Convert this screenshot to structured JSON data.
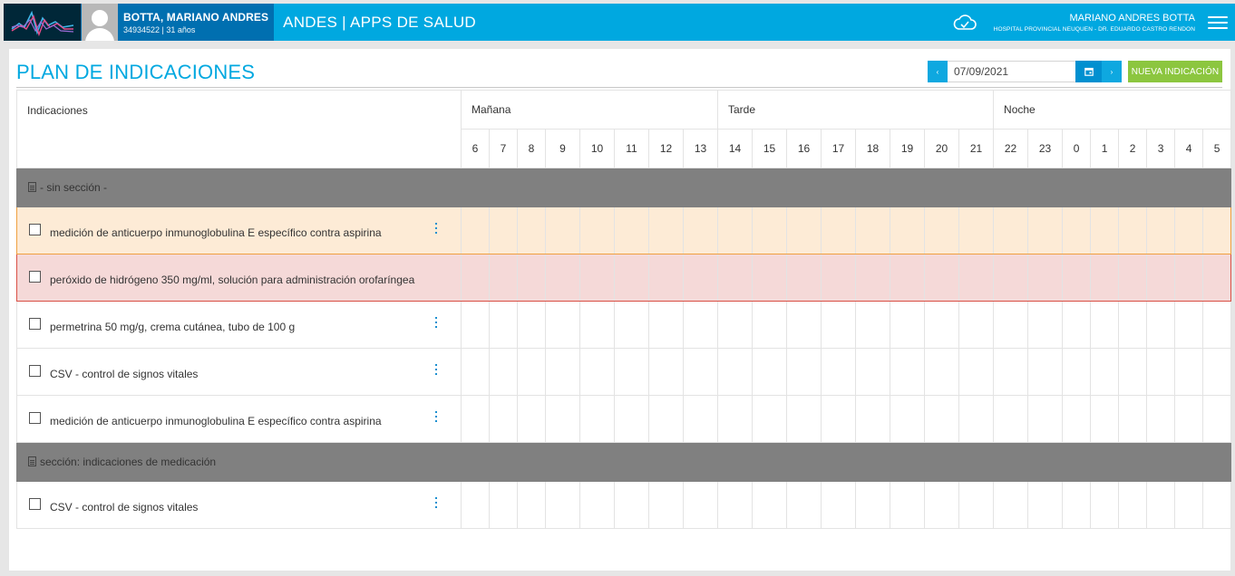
{
  "topbar": {
    "patient_name": "BOTTA, MARIANO ANDRES",
    "patient_doc": "34934522 | 31 años",
    "app_title": "ANDES | APPS DE SALUD",
    "user_name": "MARIANO ANDRES BOTTA",
    "user_hospital": "HOSPITAL PROVINCIAL NEUQUEN - DR. EDUARDO CASTRO RENDON",
    "icons": [
      "andes-logo-icon",
      "avatar-icon",
      "cloud-check-icon",
      "hamburger-menu-icon"
    ]
  },
  "page": {
    "title": "PLAN DE INDICACIONES",
    "date_value": "07/09/2021",
    "prev_glyph": "‹",
    "next_glyph": "›",
    "new_button": "NUEVA INDICACIÓN"
  },
  "table": {
    "col_indicaciones": "Indicaciones",
    "groups": [
      "Mañana",
      "Tarde",
      "Noche"
    ],
    "hours": [
      "6",
      "7",
      "8",
      "9",
      "10",
      "11",
      "12",
      "13",
      "14",
      "15",
      "16",
      "17",
      "18",
      "19",
      "20",
      "21",
      "22",
      "23",
      "0",
      "1",
      "2",
      "3",
      "4",
      "5"
    ],
    "sections": [
      {
        "label": "- sin sección -",
        "rows": [
          {
            "text": "medición de anticuerpo inmunoglobulina E específico contra aspirina",
            "status": "warning",
            "menu": true
          },
          {
            "text": "peróxido de hidrógeno 350 mg/ml, solución para administración orofaríngea",
            "status": "danger",
            "menu": false
          },
          {
            "text": "permetrina 50 mg/g, crema cutánea, tubo de 100 g",
            "status": "normal",
            "menu": true
          },
          {
            "text": "CSV - control de signos vitales",
            "status": "normal",
            "menu": true
          },
          {
            "text": "medición de anticuerpo inmunoglobulina E específico contra aspirina",
            "status": "normal",
            "menu": true
          }
        ]
      },
      {
        "label": "sección: indicaciones de medicación",
        "rows": [
          {
            "text": "CSV - control de signos vitales",
            "status": "normal",
            "menu": true
          }
        ]
      }
    ]
  },
  "colors": {
    "topbar": "#00a8e0",
    "patient_bg": "#006fb0",
    "logo_bg": "#002738",
    "accent": "#00a8e0",
    "new_button": "#8cc63f",
    "warning_bg": "#fdebd6",
    "warning_border": "#f0a040",
    "danger_bg": "#f5d9d8",
    "danger_border": "#d94f45",
    "section_bg": "#808080"
  }
}
